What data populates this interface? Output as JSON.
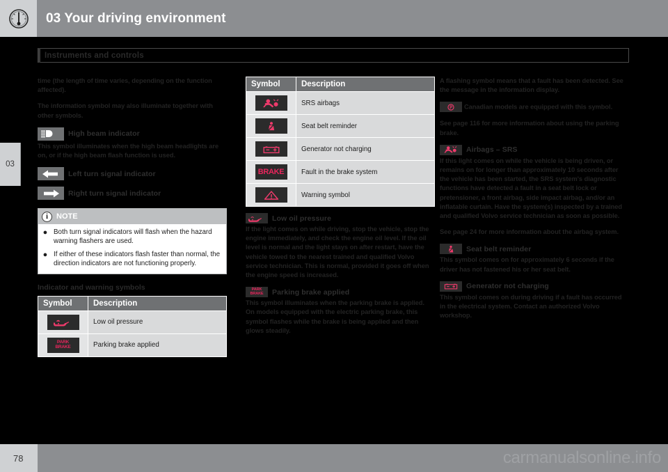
{
  "header": {
    "chapter_number": "03",
    "title": "03 Your driving environment",
    "icon": "gauge-icon"
  },
  "chapter_tab": {
    "label": "03"
  },
  "section": {
    "title": "Instruments and controls"
  },
  "left_column": {
    "para_1": "time (the length of time varies, depending on the function affected).",
    "para_2": "The information symbol may also illuminate together with other symbols.",
    "high_beam": {
      "icon": "high-beam-icon",
      "label": "High beam indicator",
      "text": "This symbol illuminates when the high beam headlights are on, or if the high beam flash function is used."
    },
    "left_turn": {
      "icon": "left-arrow-icon",
      "label": "Left turn signal indicator"
    },
    "right_turn": {
      "icon": "right-arrow-icon",
      "label": "Right turn signal indicator"
    },
    "note": {
      "icon": "info-icon",
      "title": "NOTE",
      "items": [
        "Both turn signal indicators will flash when the hazard warning flashers are used.",
        "If either of these indicators flash faster than normal, the direction indicators are not functioning properly."
      ]
    },
    "table_heading": "Indicator and warning symbols",
    "table": {
      "columns": [
        "Symbol",
        "Description"
      ],
      "rows": [
        {
          "icon": "oil-can-icon",
          "description": "Low oil pressure"
        },
        {
          "icon": "park-brake-icon",
          "description": "Parking brake applied"
        }
      ]
    }
  },
  "mid_column": {
    "table": {
      "columns": [
        "Symbol",
        "Description"
      ],
      "rows": [
        {
          "icon": "srs-airbag-icon",
          "description": "SRS airbags"
        },
        {
          "icon": "seat-belt-icon",
          "description": "Seat belt reminder"
        },
        {
          "icon": "battery-icon",
          "description": "Generator not charging"
        },
        {
          "icon": "brake-text-icon",
          "description": "Fault in the brake system"
        },
        {
          "icon": "warning-triangle-icon",
          "description": "Warning symbol"
        }
      ]
    },
    "low_oil": {
      "icon": "oil-can-icon",
      "label": "Low oil pressure",
      "text": "If the light comes on while driving, stop the vehicle, stop the engine immediately, and check the engine oil level. If the oil level is normal and the light stays on after restart, have the vehicle towed to the nearest trained and qualified Volvo service technician. This is normal, provided it goes off when the engine speed is increased."
    },
    "parking_brake": {
      "icon": "park-brake-icon",
      "label": "Parking brake applied",
      "text": "This symbol illuminates when the parking brake is applied. On models equipped with the electric parking brake, this symbol flashes while the brake is being applied and then glows steadily."
    }
  },
  "right_column": {
    "para_1": "A flashing symbol means that a fault has been detected. See the message in the information display.",
    "canadian_note": {
      "icon": "canadian-park-brake-icon",
      "text": "Canadian models are equipped with this symbol."
    },
    "para_2": "See page 116 for more information about using the parking brake.",
    "airbags": {
      "icon": "srs-airbag-icon",
      "label": "Airbags – SRS",
      "text": "If this light comes on while the vehicle is being driven, or remains on for longer than approximately 10 seconds after the vehicle has been started, the SRS system's diagnostic functions have detected a fault in a seat belt lock or pretensioner, a front airbag, side impact airbag, and/or an inflatable curtain. Have the system(s) inspected by a trained and qualified Volvo service technician as soon as possible.",
      "see_page": "See page 24 for more information about the airbag system."
    },
    "seat_belt": {
      "icon": "seat-belt-icon",
      "label": "Seat belt reminder",
      "text": "This symbol comes on for approximately 6 seconds if the driver has not fastened his or her seat belt."
    },
    "generator": {
      "icon": "battery-icon",
      "label": "Generator not charging",
      "text": "This symbol comes on during driving if a fault has occurred in the electrical system. Contact an authorized Volvo workshop."
    }
  },
  "footer": {
    "page_number": "78",
    "watermark": "carmanualsonline.info"
  },
  "colors": {
    "accent_pink": "#ee3a6b",
    "header_gray": "#8c8e91",
    "tab_gray": "#cfd1d3",
    "table_header": "#6f7173",
    "table_row": "#d9dadb",
    "chip_dark": "#2b2b2b"
  }
}
